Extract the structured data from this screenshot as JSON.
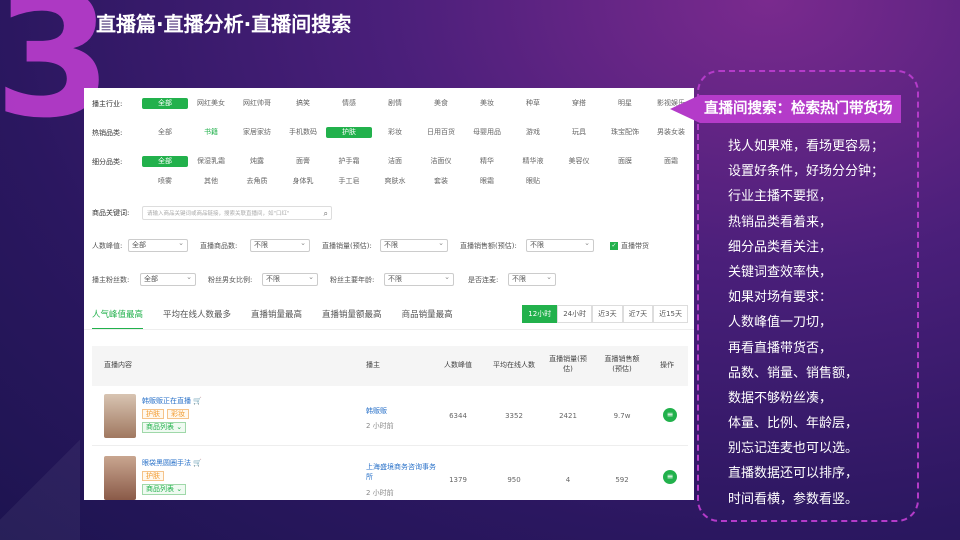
{
  "slide": {
    "number": "3",
    "title": "直播篇·直播分析·直播间搜索"
  },
  "filters": {
    "industry_label": "播主行业:",
    "industry_opts": [
      "全部",
      "网红美女",
      "网红帅哥",
      "搞笑",
      "情感",
      "剧情",
      "美食",
      "美妆",
      "种草",
      "穿搭",
      "明星",
      "影视娱乐"
    ],
    "hot_label": "热销品类:",
    "hot_opts": [
      "全部",
      "书籍",
      "家居家纺",
      "手机数码",
      "护肤",
      "彩妆",
      "日用百货",
      "母婴用品",
      "游戏",
      "玩具",
      "珠宝配饰",
      "男装女装"
    ],
    "sub_label": "细分品类:",
    "sub_opts_1": [
      "全部",
      "保湿乳霜",
      "炖露",
      "面膏",
      "护手霜",
      "洁面",
      "洁面仪",
      "精华",
      "精华液",
      "美容仪",
      "面膜",
      "面霜"
    ],
    "sub_opts_2": [
      "喷雾",
      "其他",
      "去角质",
      "身体乳",
      "手工皂",
      "爽肤水",
      "套装",
      "眼霜",
      "眼贴"
    ],
    "keyword_label": "商品关键词:",
    "keyword_placeholder": "请输入商品关键词或商品链接，搜索关联直播间，如\"口红\"",
    "peak_label": "人数峰值:",
    "peak_val": "全部",
    "goods_label": "直播商品数:",
    "goods_val": "不限",
    "sales_label": "直播销量(预估):",
    "sales_val": "不限",
    "amount_label": "直播销售额(预估):",
    "amount_val": "不限",
    "carry_label": "直播带货",
    "fans_label": "播主粉丝数:",
    "fans_val": "全部",
    "gender_label": "粉丝男女比例:",
    "gender_val": "不限",
    "age_label": "粉丝主要年龄:",
    "age_val": "不限",
    "mic_label": "是否连麦:",
    "mic_val": "不限"
  },
  "tabs": [
    "人气峰值最高",
    "平均在线人数最多",
    "直播销量最高",
    "直播销量额最高",
    "商品销量最高"
  ],
  "time_buttons": [
    "12小时",
    "24小时",
    "近3天",
    "近7天",
    "近15天"
  ],
  "table": {
    "headers": [
      "直播内容",
      "播主",
      "人数峰值",
      "平均在线人数",
      "直播销量(预估)",
      "直播销售额(预估)",
      "操作"
    ],
    "rows": [
      {
        "name": "韩贩贩正在直播",
        "tags": [
          "护肤",
          "彩妆"
        ],
        "list_btn": "商品列表 ⌄",
        "host": "韩贩贩",
        "time": "2 小时前",
        "peak": "6344",
        "avg": "3352",
        "sales": "2421",
        "amount": "9.7w"
      },
      {
        "name": "眼袋黑圆圈手法",
        "tags": [
          "护肤"
        ],
        "list_btn": "商品列表 ⌄",
        "host": "上海盛境商务咨询事务所",
        "time": "2 小时前",
        "peak": "1379",
        "avg": "950",
        "sales": "4",
        "amount": "592"
      }
    ]
  },
  "callout": {
    "banner": "直播间搜索：检索热门带货场",
    "lines": [
      "找人如果难，看场更容易；",
      "设置好条件，好场分分钟；",
      "行业主播不要抠，",
      "热销品类看着来，",
      "细分品类看关注，",
      "关键词查效率快，",
      "如果对场有要求：",
      "人数峰值一刀切，",
      "再看直播带货否，",
      "品数、销量、销售额，",
      "数据不够粉丝凑，",
      "体量、比例、年龄层，",
      "别忘记连麦也可以选。",
      "直播数据还可以排序，",
      "时间看横，参数看竖。"
    ]
  },
  "colors": {
    "accent": "#b43bc9",
    "green": "#22b14c",
    "bg": "#2b1760"
  }
}
